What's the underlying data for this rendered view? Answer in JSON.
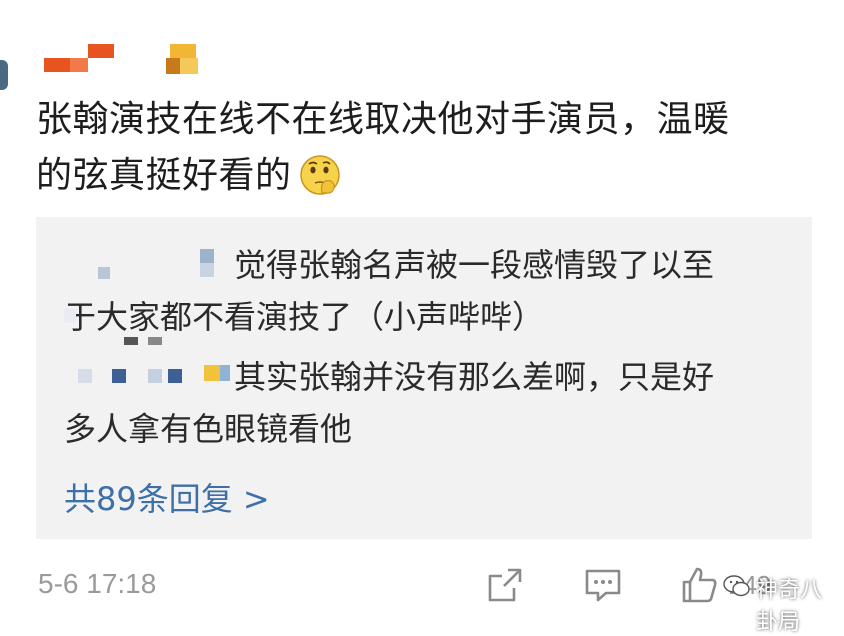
{
  "post": {
    "text_line1": "张翰演技在线不在线取决他对手演员，温暖",
    "text_line2": "的弦真挺好看的",
    "emoji": "thinking-face"
  },
  "replies": [
    {
      "text_line1": "觉得张翰名声被一段感情毁了以至",
      "text_line2": "于大家都不看演技了（小声哔哔）"
    },
    {
      "text_line1": "其实张翰并没有那么差啊，只是好",
      "text_line2": "多人拿有色眼镜看他"
    }
  ],
  "more_replies_label": "共89条回复 >",
  "footer": {
    "timestamp": "5-6 17:18",
    "like_count": "149",
    "watermark": "神奇八卦局"
  },
  "colors": {
    "link": "#3d6fa8",
    "reply_bg": "#f2f2f2",
    "meta": "#9a9a9a",
    "orange": "#e8541f",
    "yellow": "#f2b634"
  }
}
